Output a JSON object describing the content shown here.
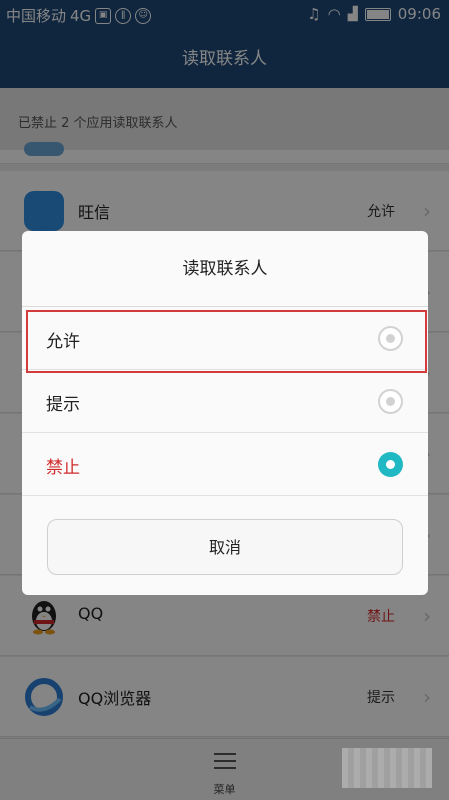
{
  "status_bar": {
    "carrier": "中国移动",
    "network": "4G",
    "time": "09:06"
  },
  "header": {
    "title": "读取联系人"
  },
  "notice": {
    "text": "已禁止 2 个应用读取联系人"
  },
  "apps": [
    {
      "name": "",
      "status": ""
    },
    {
      "name": "旺信",
      "status": "允许",
      "icon": "wangxin-icon",
      "icon_color": "#2e8ee0"
    },
    {
      "name": "",
      "status": ""
    },
    {
      "name": "",
      "status": ""
    },
    {
      "name": "",
      "status": ""
    },
    {
      "name": "QQ",
      "status": "禁止",
      "icon": "qq-penguin-icon"
    },
    {
      "name": "QQ浏览器",
      "status": "提示",
      "icon": "qq-browser-icon",
      "icon_color": "#2c7fd6"
    }
  ],
  "bottom_bar": {
    "menu_label": "菜单"
  },
  "dialog": {
    "title": "读取联系人",
    "options": [
      {
        "label": "允许",
        "selected": false
      },
      {
        "label": "提示",
        "selected": false
      },
      {
        "label": "禁止",
        "selected": true
      }
    ],
    "cancel_label": "取消"
  },
  "colors": {
    "header_bg": "#1f4a7a",
    "radio_selected": "#1fb8c3",
    "deny_text": "#d12b2b",
    "highlight_border": "#d33a3a"
  }
}
